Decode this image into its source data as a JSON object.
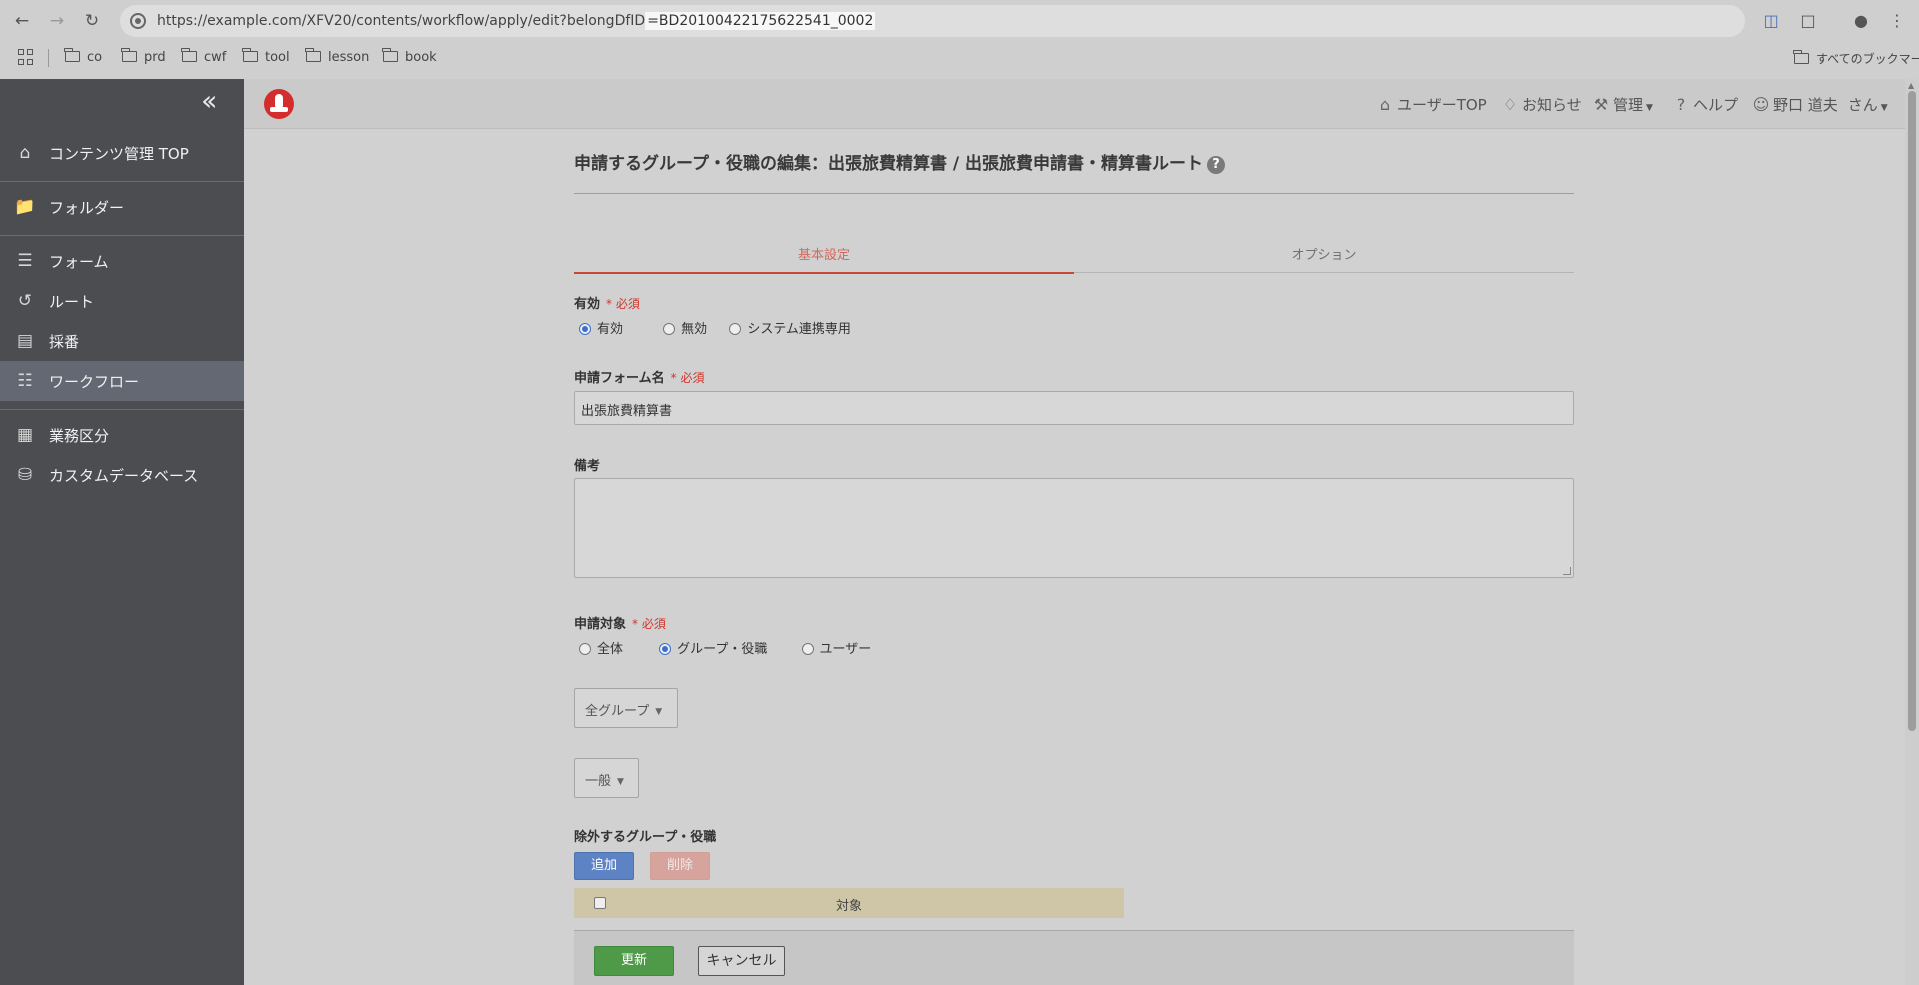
{
  "browser": {
    "url_prefix": "https://example.com/XFV20/contents/workflow/apply/edit?belongDfID",
    "url_highlight": "=BD20100422175622541_0002",
    "bookmarks": [
      "co",
      "prd",
      "cwf",
      "tool",
      "lesson",
      "book"
    ],
    "all_bookmarks": "すべてのブックマーク"
  },
  "sidebar": {
    "items": [
      {
        "label": "コンテンツ管理 TOP",
        "icon": "home-icon"
      },
      {
        "label": "フォルダー",
        "icon": "folder-gear-icon"
      },
      {
        "label": "フォーム",
        "icon": "form-icon"
      },
      {
        "label": "ルート",
        "icon": "route-icon"
      },
      {
        "label": "採番",
        "icon": "numbering-icon"
      },
      {
        "label": "ワークフロー",
        "icon": "workflow-icon"
      },
      {
        "label": "業務区分",
        "icon": "business-category-icon"
      },
      {
        "label": "カスタムデータベース",
        "icon": "database-icon"
      }
    ]
  },
  "header": {
    "user_top": "ユーザーTOP",
    "notice": "お知らせ",
    "admin": "管理",
    "help": "ヘルプ",
    "user_name": "野口 道夫",
    "user_suffix": "さん"
  },
  "page": {
    "title": "申請するグループ・役職の編集：出張旅費精算書 / 出張旅費申請書・精算書ルート",
    "tabs": [
      "基本設定",
      "オプション"
    ],
    "active_tab": "基本設定",
    "enabled": {
      "label": "有効",
      "required": "* 必須",
      "options": [
        "有効",
        "無効",
        "システム連携専用"
      ],
      "selected": "有効"
    },
    "form_name": {
      "label": "申請フォーム名",
      "required": "* 必須",
      "value": "出張旅費精算書"
    },
    "remarks": {
      "label": "備考",
      "value": ""
    },
    "target": {
      "label": "申請対象",
      "required": "* 必須",
      "options": [
        "全体",
        "グループ・役職",
        "ユーザー"
      ],
      "selected": "グループ・役職"
    },
    "group_select": "全グループ",
    "position_select": "一般",
    "exclude": {
      "label": "除外するグループ・役職",
      "add_button": "追加",
      "delete_button": "削除",
      "column_header": "対象"
    },
    "footer": {
      "update_button": "更新",
      "cancel_button": "キャンセル"
    }
  },
  "colors": {
    "sidebar_bg": "#4b4d51",
    "accent_red": "#c8463a",
    "add_blue": "#5d83c4",
    "update_green": "#4e9a48"
  }
}
